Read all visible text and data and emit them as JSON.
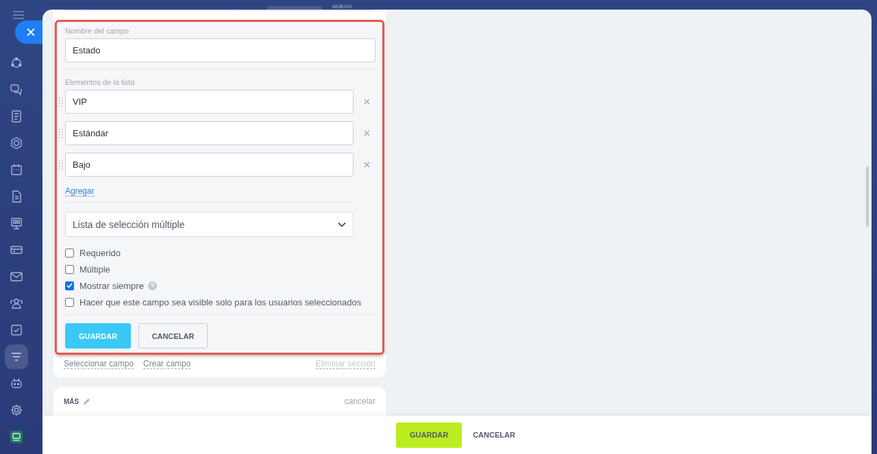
{
  "top_label": "NUEVO",
  "sidebar": [
    {
      "kind": "sync",
      "selected": false
    },
    {
      "kind": "chat",
      "selected": false
    },
    {
      "kind": "news",
      "selected": false
    },
    {
      "kind": "hexagon",
      "selected": false
    },
    {
      "kind": "calendar",
      "selected": false
    },
    {
      "kind": "file",
      "selected": false
    },
    {
      "kind": "board",
      "selected": false
    },
    {
      "kind": "card",
      "selected": false
    },
    {
      "kind": "mail",
      "selected": false
    },
    {
      "kind": "people",
      "selected": false
    },
    {
      "kind": "task",
      "selected": false
    },
    {
      "kind": "funnel",
      "selected": true
    },
    {
      "kind": "robot",
      "selected": false
    },
    {
      "kind": "gear",
      "selected": false
    },
    {
      "kind": "app",
      "selected": false
    }
  ],
  "field_name": {
    "label": "Nombre del campo",
    "value": "Estado"
  },
  "list": {
    "label": "Elementos de la lista",
    "items": [
      "VIP",
      "Estándar",
      "Bajo"
    ],
    "add_link": "Agregar"
  },
  "type_select": {
    "value": "Lista de selección múltiple"
  },
  "options": [
    {
      "label": "Requerido",
      "checked": false,
      "help": false
    },
    {
      "label": "Múltiple",
      "checked": false,
      "help": false
    },
    {
      "label": "Mostrar siempre",
      "checked": true,
      "help": true
    },
    {
      "label": "Hacer que este campo sea visible solo para los usuarios seleccionados",
      "checked": false,
      "help": false
    }
  ],
  "form_buttons": {
    "save": "GUARDAR",
    "cancel": "CANCELAR"
  },
  "section_links": [
    "Seleccionar campo",
    "Crear campo"
  ],
  "delete_section": "Eliminar sección",
  "next_section": {
    "title": "MÁS",
    "cancel": "cancelar"
  },
  "footer": {
    "save": "GUARDAR",
    "cancel": "CANCELAR"
  }
}
